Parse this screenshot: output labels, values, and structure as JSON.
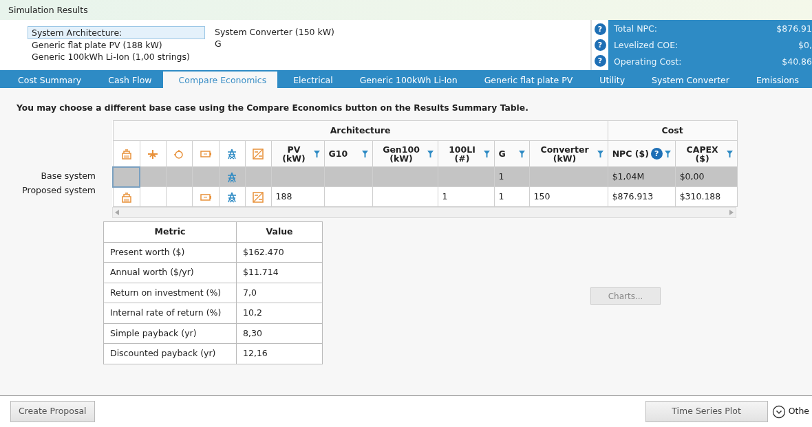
{
  "window": {
    "title": "Simulation Results"
  },
  "architecture": {
    "heading": "System Architecture:",
    "items": [
      "Generic flat plate PV (188 kW)",
      "Generic 100kWh Li-Ion (1,00 strings)"
    ],
    "items_right": [
      "System Converter (150 kW)",
      "G"
    ]
  },
  "summary": [
    {
      "help": "?",
      "label": "Total NPC:",
      "value": "$876.91"
    },
    {
      "help": "?",
      "label": "Levelized COE:",
      "value": "$0,"
    },
    {
      "help": "?",
      "label": "Operating Cost:",
      "value": "$40.86"
    }
  ],
  "tabs": [
    {
      "label": "Cost Summary",
      "selected": false
    },
    {
      "label": "Cash Flow",
      "selected": false
    },
    {
      "label": "Compare Economics",
      "selected": true
    },
    {
      "label": "Electrical",
      "selected": false
    },
    {
      "label": "Generic 100kWh Li-Ion",
      "selected": false
    },
    {
      "label": "Generic flat plate PV",
      "selected": false
    },
    {
      "label": "Utility",
      "selected": false
    },
    {
      "label": "System Converter",
      "selected": false
    },
    {
      "label": "Emissions",
      "selected": false
    }
  ],
  "instruction": "You may choose a different base case using the Compare Economics button on the Results Summary Table.",
  "compare_table": {
    "groups": [
      {
        "label": "Architecture",
        "columns": [
          {
            "label": "PV (kW)"
          },
          {
            "label": "G10"
          },
          {
            "label": "Gen100 (kW)"
          },
          {
            "label": "100LI (#)"
          },
          {
            "label": "G"
          },
          {
            "label": "Converter (kW)"
          }
        ]
      },
      {
        "label": "Cost",
        "columns": [
          {
            "label": "NPC ($)",
            "help_text": "?"
          },
          {
            "label": "CAPEX ($)"
          }
        ]
      }
    ],
    "rows": [
      {
        "label": "Base system",
        "selected": true,
        "components": [
          false,
          false,
          false,
          false,
          true,
          false
        ],
        "cells": [
          {
            "blank": true
          },
          {
            "blank": true
          },
          {
            "blank": true
          },
          {
            "blank": true
          },
          {
            "text": "1"
          },
          {
            "blank": true
          },
          {
            "text": "$1,04M"
          },
          {
            "text": "$0,00"
          }
        ]
      },
      {
        "label": "Proposed system",
        "selected": false,
        "components": [
          true,
          false,
          false,
          true,
          true,
          true
        ],
        "cells": [
          {
            "text": "188"
          },
          {
            "blank": true
          },
          {
            "blank": true
          },
          {
            "text": "1"
          },
          {
            "text": "1"
          },
          {
            "text": "150"
          },
          {
            "text": "$876.913"
          },
          {
            "text": "$310.188"
          }
        ]
      }
    ]
  },
  "metrics": {
    "columns": [
      "Metric",
      "Value"
    ],
    "rows": [
      [
        "Present worth ($)",
        "$162.470"
      ],
      [
        "Annual worth ($/yr)",
        "$11.714"
      ],
      [
        "Return on investment (%)",
        "7,0"
      ],
      [
        "Internal rate of return (%)",
        "10,2"
      ],
      [
        "Simple payback (yr)",
        "8,30"
      ],
      [
        "Discounted payback (yr)",
        "12,16"
      ]
    ]
  },
  "charts_button": {
    "label": "Charts...",
    "disabled": true
  },
  "footer": {
    "create_proposal": "Create Proposal",
    "time_series": "Time Series Plot",
    "other": "Othe"
  }
}
